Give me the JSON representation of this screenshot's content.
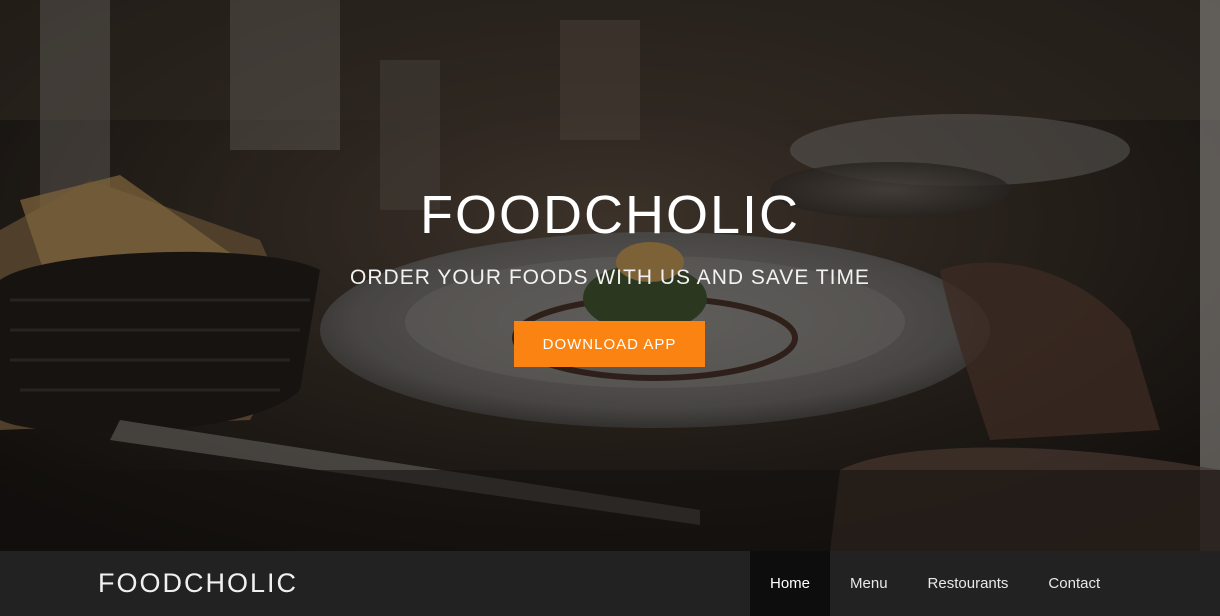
{
  "hero": {
    "title": "FOODCHOLIC",
    "subtitle": "ORDER YOUR FOODS WITH US AND SAVE TIME",
    "button_label": "DOWNLOAD APP",
    "accent_color": "#fb8312"
  },
  "navbar": {
    "brand": "FOODCHOLIC",
    "items": [
      {
        "label": "Home",
        "active": true
      },
      {
        "label": "Menu",
        "active": false
      },
      {
        "label": "Restourants",
        "active": false
      },
      {
        "label": "Contact",
        "active": false
      }
    ]
  }
}
